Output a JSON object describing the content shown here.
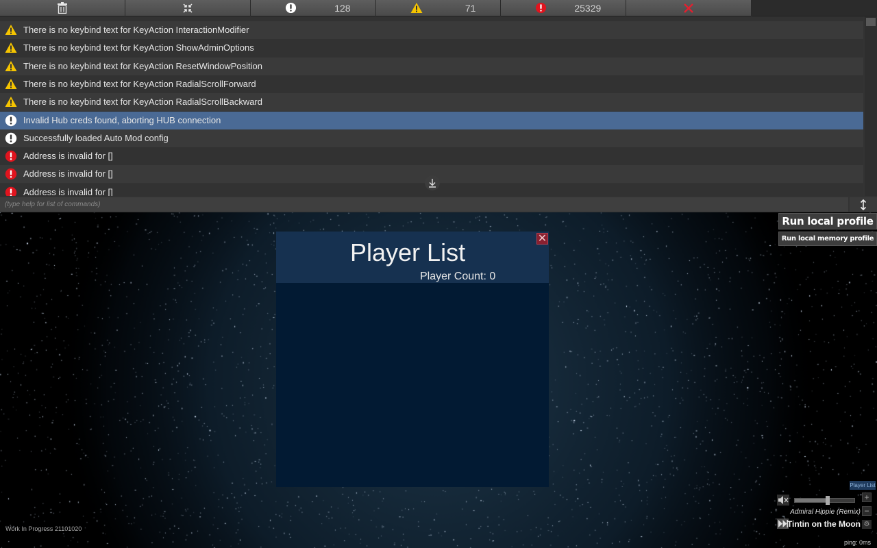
{
  "toolbar": {
    "buttons": [
      {
        "name": "clear-console",
        "icon": "trash-icon"
      },
      {
        "name": "collapse-console",
        "icon": "collapse-arrows-icon"
      },
      {
        "name": "info-filter",
        "icon": "info-circle-icon",
        "count": "128"
      },
      {
        "name": "warning-filter",
        "icon": "warning-triangle-icon",
        "count": "71"
      },
      {
        "name": "error-filter",
        "icon": "error-circle-icon",
        "count": "25329"
      },
      {
        "name": "close-console",
        "icon": "close-x-icon"
      }
    ]
  },
  "log": {
    "partial_top_type": "warning",
    "entries": [
      {
        "type": "warning",
        "text": "There is no keybind text for KeyAction InteractionModifier"
      },
      {
        "type": "warning",
        "text": "There is no keybind text for KeyAction ShowAdminOptions"
      },
      {
        "type": "warning",
        "text": "There is no keybind text for KeyAction ResetWindowPosition"
      },
      {
        "type": "warning",
        "text": "There is no keybind text for KeyAction RadialScrollForward"
      },
      {
        "type": "warning",
        "text": "There is no keybind text for KeyAction RadialScrollBackward"
      },
      {
        "type": "info",
        "text": "Invalid Hub creds found, aborting HUB connection",
        "selected": true
      },
      {
        "type": "info",
        "text": "Successfully loaded Auto Mod config"
      },
      {
        "type": "error",
        "text": "Address is invalid for []"
      },
      {
        "type": "error",
        "text": "Address is invalid for []"
      },
      {
        "type": "error",
        "text": "Address is invalid for []"
      }
    ]
  },
  "console_input": {
    "placeholder": "(type help for list of commands)",
    "value": ""
  },
  "profile": {
    "run_local_profile": "Run local profile",
    "run_local_memory_profile": "Run local memory profile"
  },
  "player_list": {
    "title": "Player List",
    "count_label": "Player Count: 0",
    "close_glyph": "✕"
  },
  "music": {
    "player_list_tab": "Player List",
    "artist": "Admiral Hippie (Remix)",
    "track": "Tintin on the Moon",
    "volume": 0.55,
    "plus": "+",
    "minus": "−",
    "gear": "⚙"
  },
  "footer": {
    "version": "Work In Progress 21101020",
    "ping": "ping: 0ms"
  },
  "colors": {
    "warning": "#f5c400",
    "info": "#ffffff",
    "error": "#e0141e",
    "selected_row": "#4a6a95",
    "panel_bg": "#021a33",
    "panel_header": "#163150"
  }
}
